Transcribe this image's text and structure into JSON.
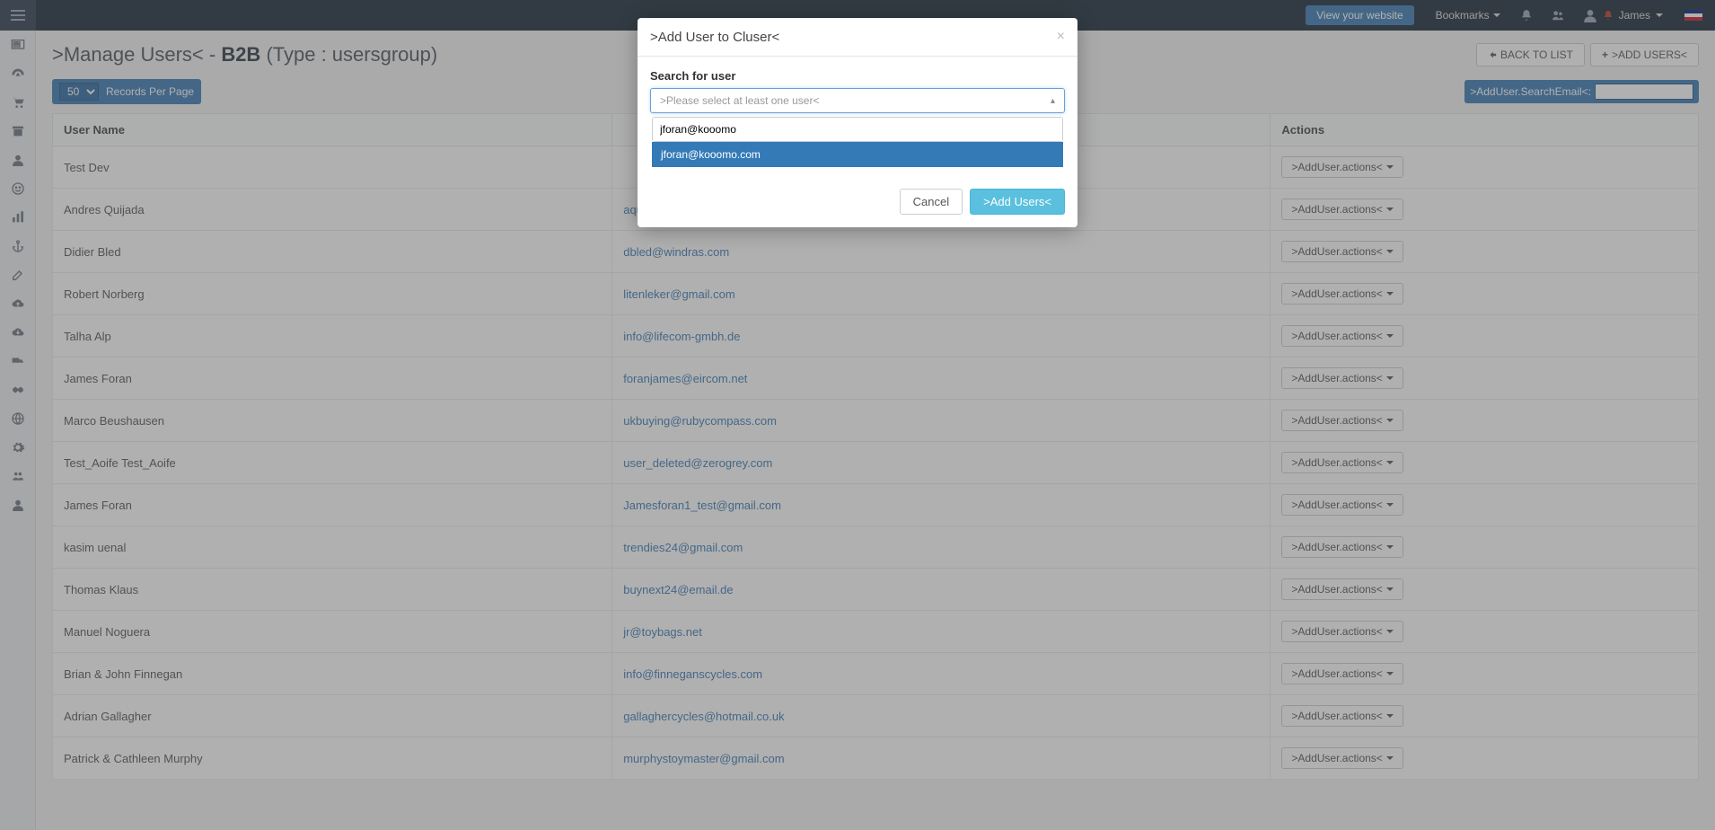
{
  "topbar": {
    "view_website": "View your website",
    "bookmarks": "Bookmarks",
    "username": "James"
  },
  "page": {
    "title_prefix": ">Manage Users< - ",
    "title_bold": "B2B",
    "title_suffix": " (Type : usersgroup)",
    "back_to_list": "BACK TO LIST",
    "add_users": ">ADD USERS<"
  },
  "toolbar": {
    "records_value": "50",
    "records_label": "Records Per Page",
    "search_email_label": ">AddUser.SearchEmail<:"
  },
  "table": {
    "headers": {
      "name": "User Name",
      "email": "",
      "actions": "Actions"
    },
    "action_label": ">AddUser.actions<",
    "rows": [
      {
        "name": "Test Dev",
        "email": ""
      },
      {
        "name": "Andres Quijada",
        "email": "aquijada@zerogrey.com"
      },
      {
        "name": "Didier Bled",
        "email": "dbled@windras.com"
      },
      {
        "name": "Robert Norberg",
        "email": "litenleker@gmail.com"
      },
      {
        "name": "Talha Alp",
        "email": "info@lifecom-gmbh.de"
      },
      {
        "name": "James Foran",
        "email": "foranjames@eircom.net"
      },
      {
        "name": "Marco Beushausen",
        "email": "ukbuying@rubycompass.com"
      },
      {
        "name": "Test_Aoife Test_Aoife",
        "email": "user_deleted@zerogrey.com"
      },
      {
        "name": "James Foran",
        "email": "Jamesforan1_test@gmail.com"
      },
      {
        "name": "kasim uenal",
        "email": "trendies24@gmail.com"
      },
      {
        "name": "Thomas Klaus",
        "email": "buynext24@email.de"
      },
      {
        "name": "Manuel Noguera",
        "email": "jr@toybags.net"
      },
      {
        "name": "Brian & John Finnegan",
        "email": "info@finneganscycles.com"
      },
      {
        "name": "Adrian Gallagher",
        "email": "gallaghercycles@hotmail.co.uk"
      },
      {
        "name": "Patrick & Cathleen Murphy",
        "email": "murphystoymaster@gmail.com"
      }
    ]
  },
  "modal": {
    "title": ">Add User to Cluser<",
    "search_label": "Search for user",
    "placeholder": ">Please select at least one user<",
    "input_value": "jforan@kooomo",
    "suggestion": "jforan@kooomo.com",
    "cancel": "Cancel",
    "confirm": ">Add Users<"
  }
}
